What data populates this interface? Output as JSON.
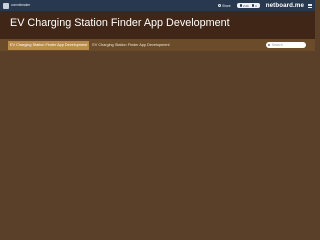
{
  "topbar": {
    "username": "commitmaker",
    "share_label": "Share",
    "stats": [
      {
        "icon": "eye-icon",
        "value": "2.0k"
      },
      {
        "icon": "star-icon",
        "value": "0"
      }
    ],
    "brand": "netboard.me"
  },
  "header": {
    "title": "EV Charging Station Finder App Development"
  },
  "tabs": [
    {
      "label": "EV Charging Station Finder App Development",
      "active": true
    },
    {
      "label": "EV Charging Station Finder App Development",
      "active": false
    }
  ],
  "search": {
    "placeholder": "Search"
  },
  "colors": {
    "topbar": "#27384f",
    "header": "#3f2617",
    "tabbar": "#6b4c2a",
    "active_tab": "#b98c4a",
    "board": "#5b4029"
  }
}
